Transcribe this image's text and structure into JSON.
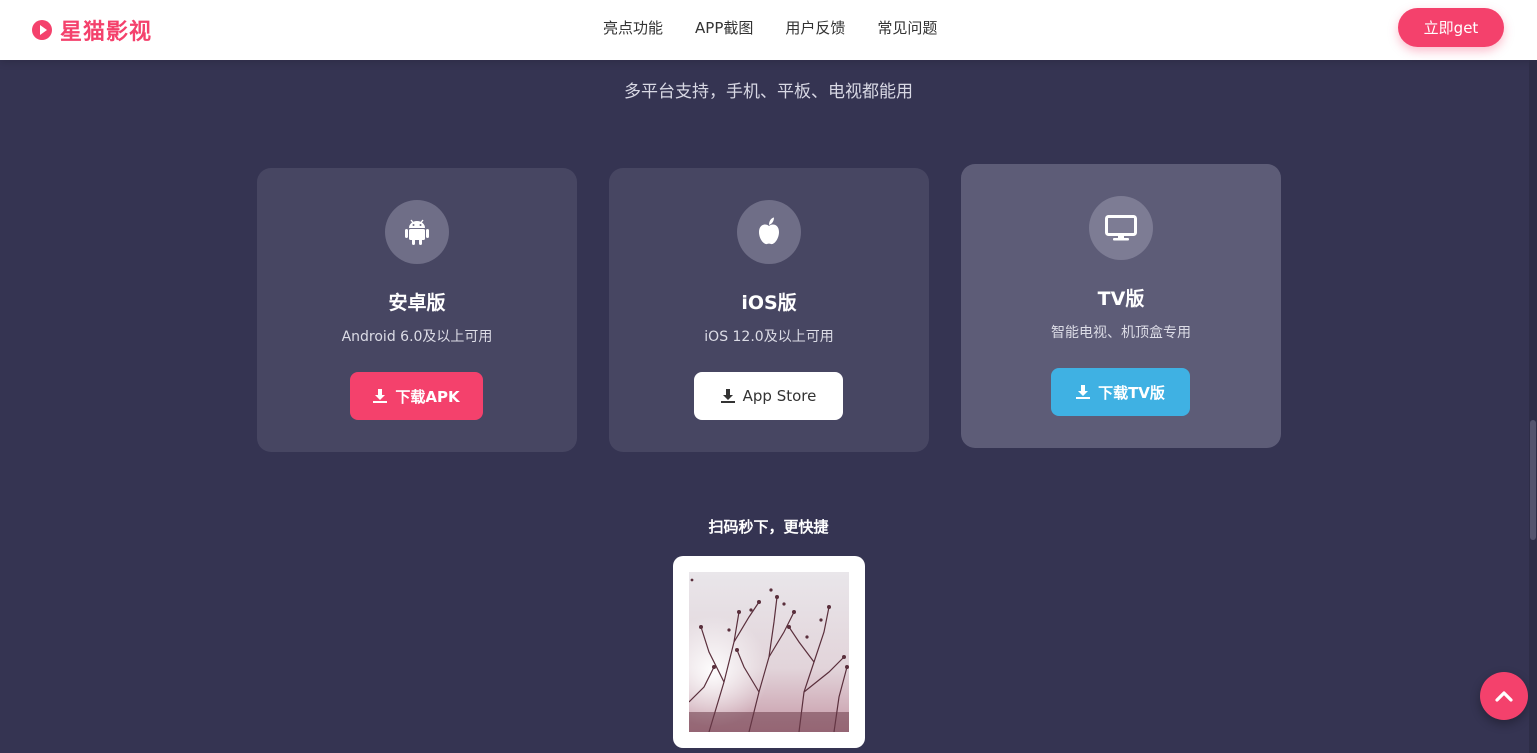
{
  "brand": {
    "name": "星猫影视",
    "color": "#f4416c"
  },
  "nav": {
    "items": [
      "亮点功能",
      "APP截图",
      "用户反馈",
      "常见问题"
    ],
    "cta_label": "立即get"
  },
  "hero": {
    "subtitle": "多平台支持，手机、平板、电视都能用"
  },
  "cards": [
    {
      "icon": "android-icon",
      "title": "安卓版",
      "desc": "Android 6.0及以上可用",
      "button": "下载APK",
      "button_color": "#f4416c"
    },
    {
      "icon": "apple-icon",
      "title": "iOS版",
      "desc": "iOS 12.0及以上可用",
      "button": "App Store",
      "button_color": "#ffffff"
    },
    {
      "icon": "tv-icon",
      "title": "TV版",
      "desc": "智能电视、机顶盒专用",
      "button": "下载TV版",
      "button_color": "#3fb1e3"
    }
  ],
  "qr": {
    "label": "扫码秒下，更快捷"
  }
}
